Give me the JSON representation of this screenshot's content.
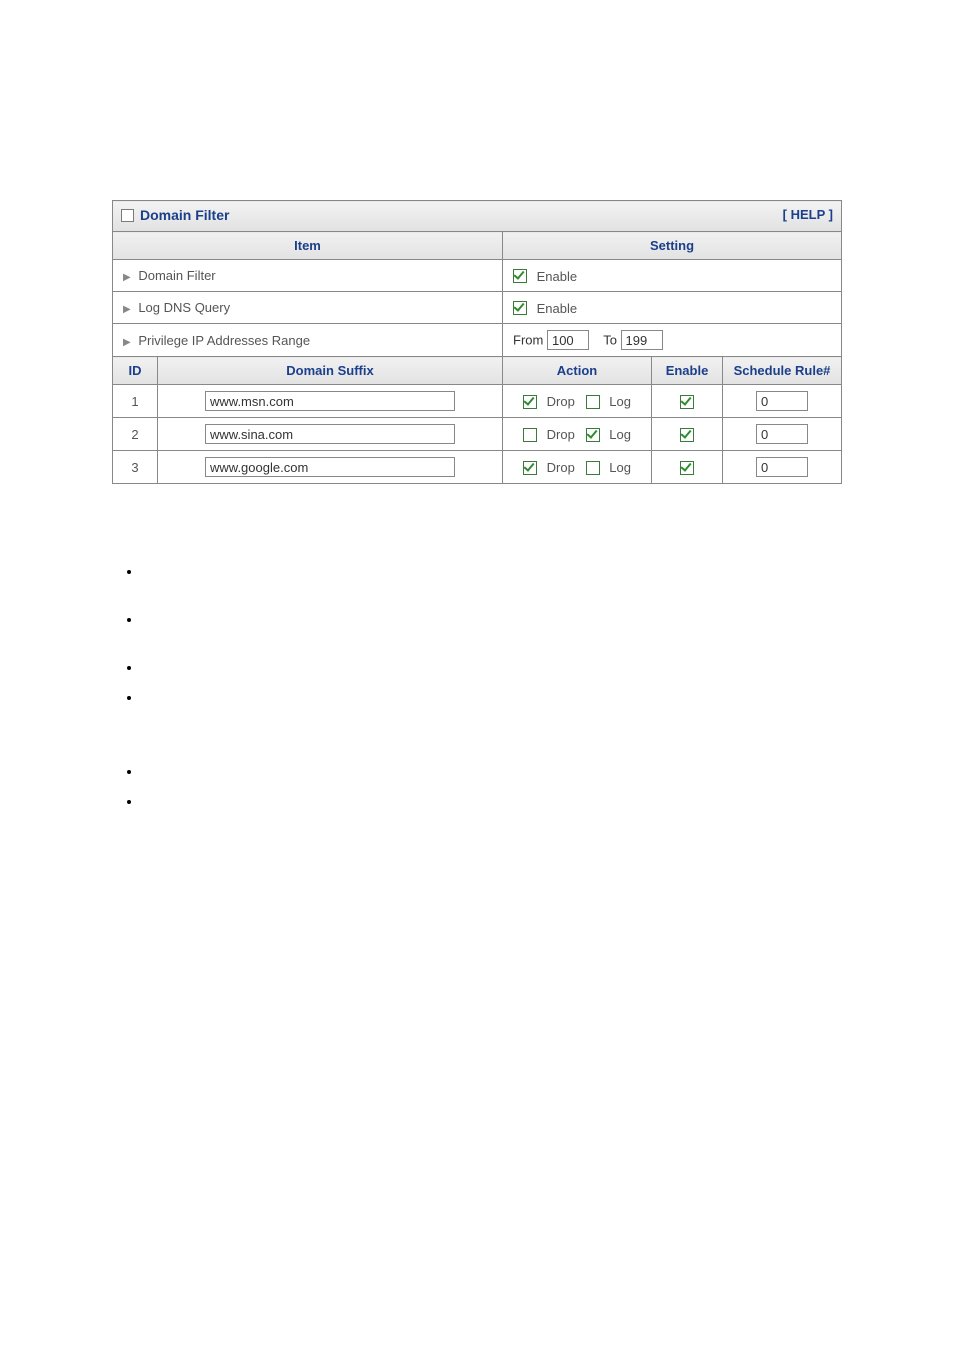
{
  "titlebar": {
    "title": "Domain Filter",
    "help": "[ HELP ]"
  },
  "headers": {
    "item": "Item",
    "setting": "Setting",
    "id": "ID",
    "domain_suffix": "Domain Suffix",
    "action": "Action",
    "enable": "Enable",
    "schedule": "Schedule Rule#"
  },
  "items": {
    "domain_filter": {
      "label": "Domain Filter",
      "enable_label": "Enable",
      "checked": true
    },
    "log_dns": {
      "label": "Log DNS Query",
      "enable_label": "Enable",
      "checked": true
    },
    "priv_range": {
      "label": "Privilege IP Addresses Range",
      "from_label": "From",
      "from_value": "100",
      "to_label": "To",
      "to_value": "199"
    }
  },
  "labels": {
    "drop": "Drop",
    "log": "Log"
  },
  "rows": [
    {
      "id": "1",
      "suffix": "www.msn.com",
      "drop": true,
      "log": false,
      "enable": true,
      "schedule": "0"
    },
    {
      "id": "2",
      "suffix": "www.sina.com",
      "drop": false,
      "log": true,
      "enable": true,
      "schedule": "0"
    },
    {
      "id": "3",
      "suffix": "www.google.com",
      "drop": true,
      "log": false,
      "enable": true,
      "schedule": "0"
    }
  ]
}
